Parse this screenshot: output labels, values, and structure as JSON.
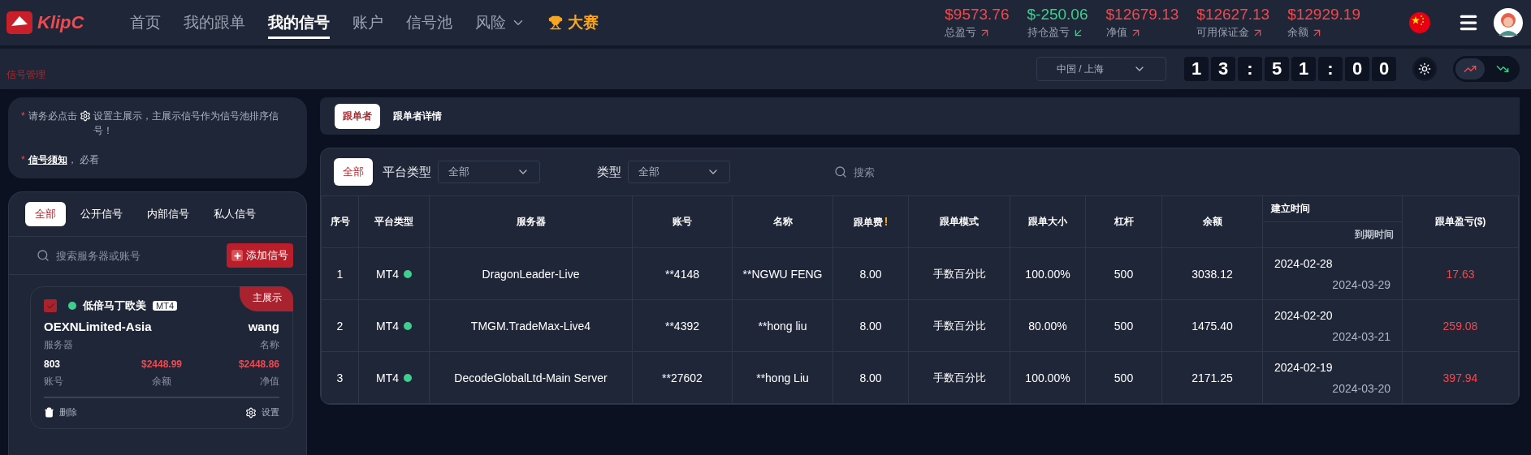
{
  "logo": {
    "text": "KlipC"
  },
  "nav": [
    {
      "label": "首页",
      "selected": false
    },
    {
      "label": "我的跟单",
      "selected": false
    },
    {
      "label": "我的信号",
      "selected": true
    },
    {
      "label": "账户",
      "selected": false
    },
    {
      "label": "信号池",
      "selected": false
    },
    {
      "label": "风险",
      "selected": false,
      "dropdown": true
    },
    {
      "label": "大赛",
      "selected": false,
      "kind": "contest"
    }
  ],
  "stats": [
    {
      "value": "$9573.76",
      "label": "总盈亏",
      "rising": true
    },
    {
      "value": "$-250.06",
      "label": "持仓盈亏",
      "rising": false
    },
    {
      "value": "$12679.13",
      "label": "净值",
      "rising": true
    },
    {
      "value": "$12627.13",
      "label": "可用保证金",
      "rising": true
    },
    {
      "value": "$12929.19",
      "label": "余额",
      "rising": true
    }
  ],
  "page_title": "信号管理",
  "region": "中国 / 上海",
  "clock": [
    "1",
    "3",
    ":",
    "5",
    "1",
    ":",
    "0",
    "0"
  ],
  "trend_toggle": [
    {
      "rising": true,
      "selected": true
    },
    {
      "rising": false,
      "selected": false
    }
  ],
  "notice": {
    "line1_mark": "*",
    "line1_before": "请务必点击",
    "line1_after": "设置主展示，主展示信号作为信号池排序信号！",
    "line2_mark": "*",
    "line2_link": "信号须知",
    "line2_after": "， 必看"
  },
  "signal_tabs": [
    {
      "label": "全部",
      "selected": true
    },
    {
      "label": "公开信号",
      "selected": false
    },
    {
      "label": "内部信号",
      "selected": false
    },
    {
      "label": "私人信号",
      "selected": false
    }
  ],
  "signal_search": {
    "placeholder": "搜索服务器或账号"
  },
  "add_button": "添加信号",
  "signal_card": {
    "checked": true,
    "online": true,
    "name": "低倍马丁欧美",
    "platform": "MT4",
    "badge": "主展示",
    "server": "OEXNLimited-Asia",
    "server_label": "服务器",
    "holder": "wang",
    "holder_label": "名称",
    "account": "803",
    "account_label": "账号",
    "balance": "$2448.99",
    "balance_label": "余额",
    "equity": "$2448.86",
    "equity_label": "净值",
    "delete": "删除",
    "settings": "设置"
  },
  "follower_tabs": [
    {
      "label": "跟单者",
      "selected": true
    },
    {
      "label": "跟单者详情",
      "selected": false
    }
  ],
  "filters": {
    "all": "全部",
    "platform_label": "平台类型",
    "platform_value": "全部",
    "type_label": "类型",
    "type_value": "全部",
    "search_placeholder": "搜索"
  },
  "table": {
    "fee_mark": "!",
    "columns": [
      "序号",
      "平台类型",
      "服务器",
      "账号",
      "名称",
      "跟单费",
      "跟单模式",
      "跟单大小",
      "杠杆",
      "余额",
      "建立时间",
      "到期时间",
      "跟单盈亏($)"
    ],
    "rows": [
      {
        "index": "1",
        "platform": "MT4",
        "color": "#3ecf8e",
        "server": "DragonLeader-Live",
        "account": "**4148",
        "name": "**NGWU FENG",
        "fee": "8.00",
        "mode": "手数百分比",
        "size": "100.00%",
        "leverage": "500",
        "balance": "3038.12",
        "created": "2024-02-28",
        "expires": "2024-03-29",
        "profit": "17.63"
      },
      {
        "index": "2",
        "platform": "MT4",
        "color": "#3ecf8e",
        "server": "TMGM.TradeMax-Live4",
        "account": "**4392",
        "name": "**hong liu",
        "fee": "8.00",
        "mode": "手数百分比",
        "size": "80.00%",
        "leverage": "500",
        "balance": "1475.40",
        "created": "2024-02-20",
        "expires": "2024-03-21",
        "profit": "259.08"
      },
      {
        "index": "3",
        "platform": "MT4",
        "color": "#3ecf8e",
        "server": "DecodeGlobalLtd-Main Server",
        "account": "**27602",
        "name": "**hong Liu",
        "fee": "8.00",
        "mode": "手数百分比",
        "size": "100.00%",
        "leverage": "500",
        "balance": "2171.25",
        "created": "2024-02-19",
        "expires": "2024-03-20",
        "profit": "397.94"
      }
    ]
  }
}
